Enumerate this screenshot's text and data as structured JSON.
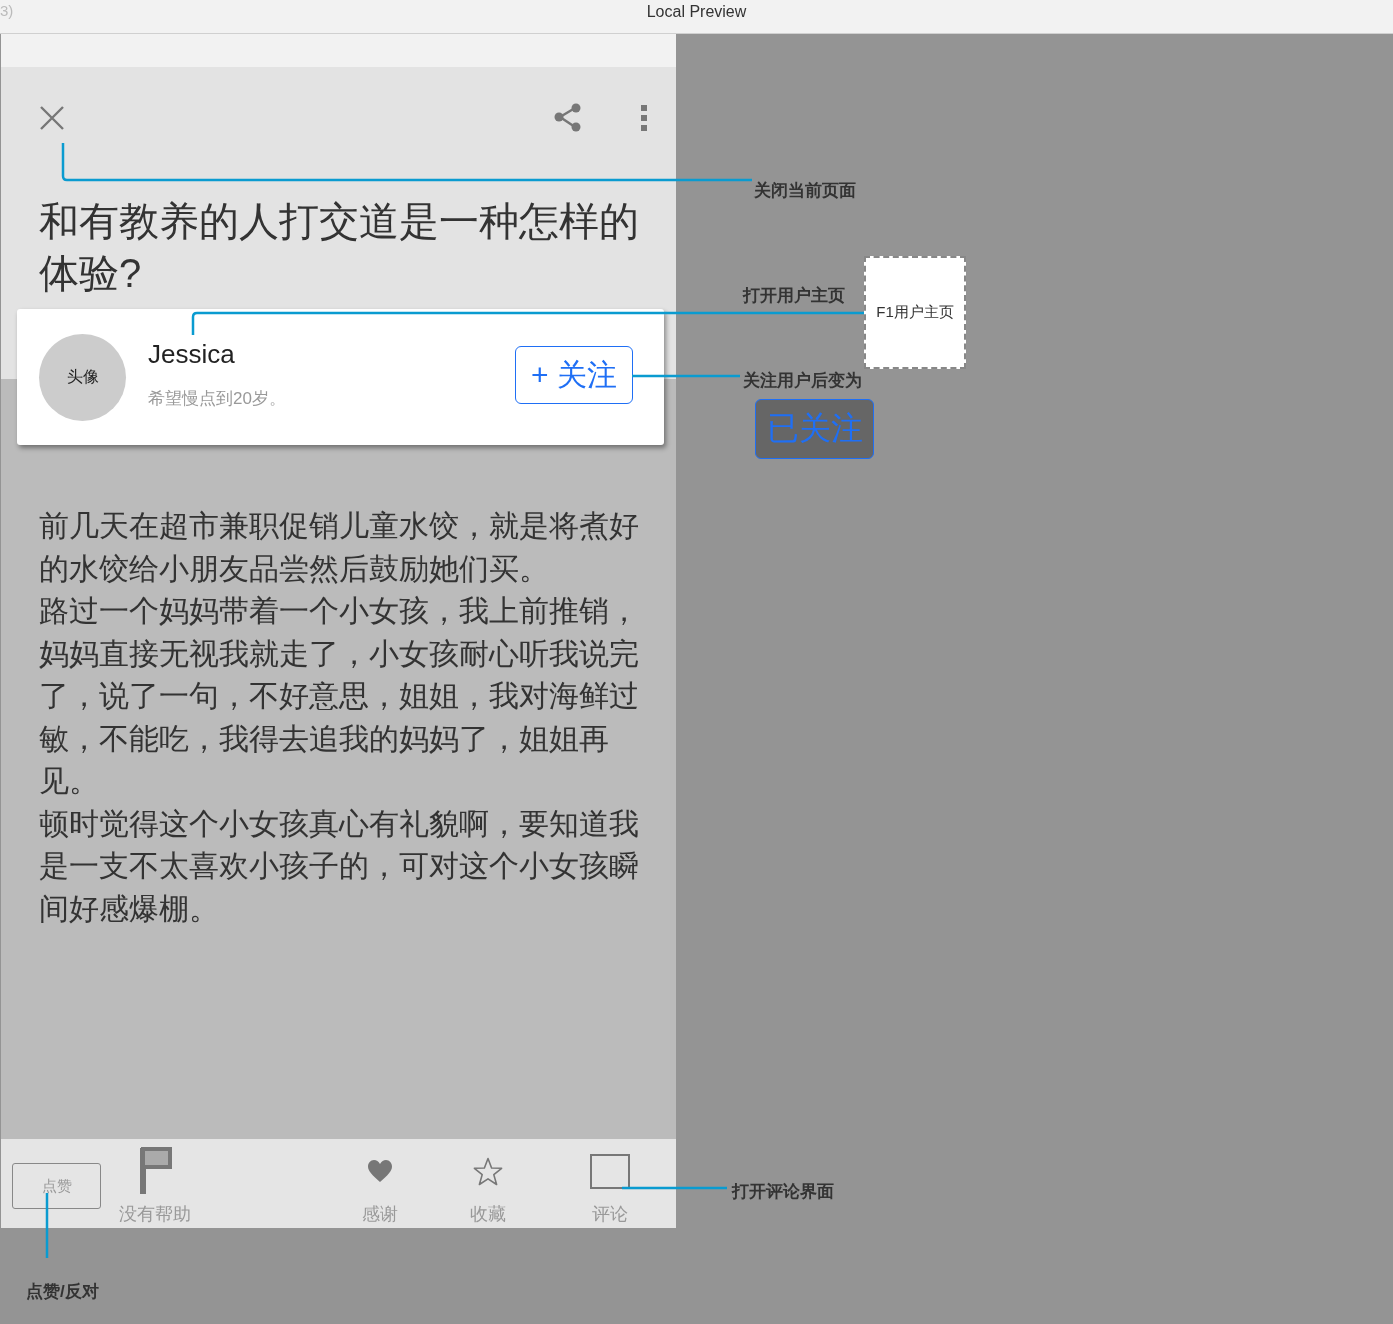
{
  "window": {
    "tab_fragment": "3)",
    "title": "Local Preview"
  },
  "question": {
    "title": "和有教养的人打交道是一种怎样的体验?"
  },
  "author": {
    "avatar_label": "头像",
    "name": "Jessica",
    "bio": "希望慢点到20岁。",
    "follow_button": "+ 关注"
  },
  "answer": {
    "paragraphs": [
      "前几天在超市兼职促销儿童水饺，就是将煮好的水饺给小朋友品尝然后鼓励她们买。",
      "路过一个妈妈带着一个小女孩，我上前推销，妈妈直接无视我就走了，小女孩耐心听我说完了，说了一句，不好意思，姐姐，我对海鲜过敏，不能吃，我得去追我的妈妈了，姐姐再见。",
      "顿时觉得这个小女孩真心有礼貌啊，要知道我是一支不太喜欢小孩子的，可对这个小女孩瞬间好感爆棚。"
    ]
  },
  "bottom_bar": {
    "like_button": "点赞",
    "actions": [
      {
        "kind": "flag",
        "label": "没有帮助"
      },
      {
        "kind": "heart",
        "label": "感谢"
      },
      {
        "kind": "star",
        "label": "收藏"
      },
      {
        "kind": "comment",
        "label": "评论"
      }
    ]
  },
  "annotations": {
    "close_note": "关闭当前页面",
    "profile_note": "打开用户主页",
    "profile_target": "F1用户主页",
    "follow_note": "关注用户后变为",
    "followed_button": "已关注",
    "comment_note": "打开评论界面",
    "like_note": "点赞/反对"
  }
}
